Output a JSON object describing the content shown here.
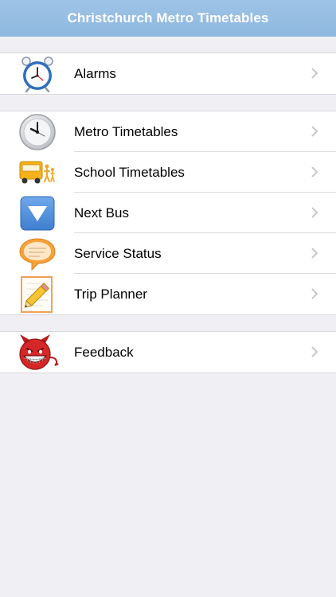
{
  "header": {
    "title": "Christchurch Metro Timetables"
  },
  "groups": [
    {
      "items": [
        {
          "label": "Alarms",
          "icon": "alarm-clock-icon"
        }
      ]
    },
    {
      "items": [
        {
          "label": "Metro Timetables",
          "icon": "clock-icon"
        },
        {
          "label": "School Timetables",
          "icon": "school-bus-icon"
        },
        {
          "label": "Next Bus",
          "icon": "down-triangle-icon"
        },
        {
          "label": "Service Status",
          "icon": "speech-bubble-icon"
        },
        {
          "label": "Trip Planner",
          "icon": "notepad-pencil-icon"
        }
      ]
    },
    {
      "items": [
        {
          "label": "Feedback",
          "icon": "devil-face-icon"
        }
      ]
    }
  ],
  "colors": {
    "navbar": "#94bce2",
    "background": "#efeff4",
    "chevron": "#c7c7cc"
  }
}
